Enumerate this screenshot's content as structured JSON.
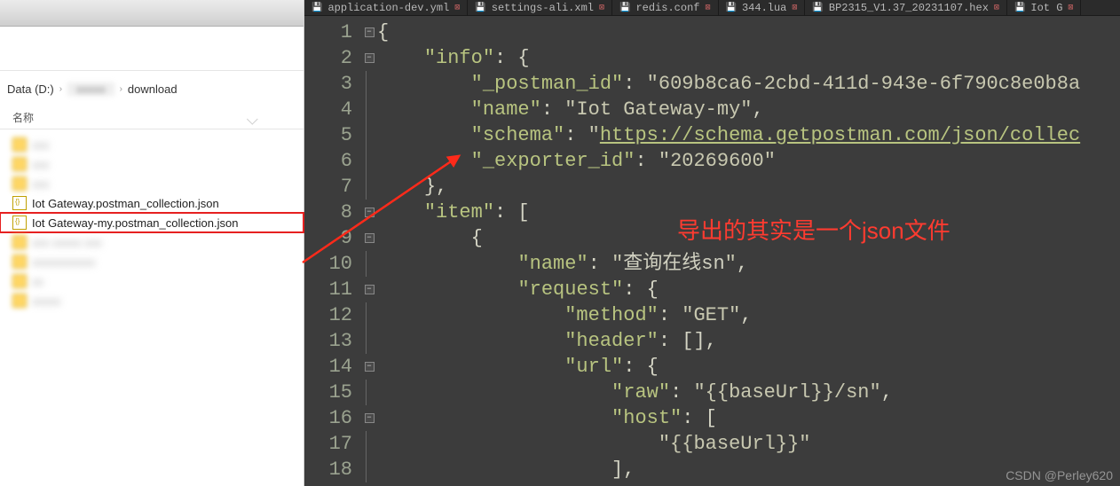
{
  "explorer": {
    "breadcrumb": {
      "drive": "Data (D:)",
      "mid_blur": "xxxxx",
      "folder": "download"
    },
    "column_header": "名称",
    "files": [
      {
        "label": "xxx",
        "icon": "folder",
        "blurred": true
      },
      {
        "label": "xxx",
        "icon": "folder",
        "blurred": true
      },
      {
        "label": "xxx",
        "icon": "folder",
        "blurred": true
      },
      {
        "label": "Iot Gateway.postman_collection.json",
        "icon": "json",
        "blurred": false
      },
      {
        "label": "Iot Gateway-my.postman_collection.json",
        "icon": "json",
        "blurred": false,
        "highlighted": true
      },
      {
        "label": "xxx xxxxx xxx",
        "icon": "folder",
        "blurred": true
      },
      {
        "label": "xxxxxxxxxxx",
        "icon": "folder",
        "blurred": true
      },
      {
        "label": "xx",
        "icon": "folder",
        "blurred": true
      },
      {
        "label": "xxxxx",
        "icon": "folder",
        "blurred": true
      }
    ]
  },
  "editor": {
    "tabs": [
      {
        "name": "application-dev.yml"
      },
      {
        "name": "settings-ali.xml"
      },
      {
        "name": "redis.conf"
      },
      {
        "name": "344.lua"
      },
      {
        "name": "BP2315_V1.37_20231107.hex"
      },
      {
        "name": "Iot G"
      }
    ],
    "json_content": {
      "info": {
        "_postman_id": "609b8ca6-2cbd-411d-943e-6f790c8e0b8a",
        "name": "Iot Gateway-my",
        "schema": "https://schema.getpostman.com/json/collec",
        "_exporter_id": "20269600"
      },
      "item": [
        {
          "name": "查询在线sn",
          "request": {
            "method": "GET",
            "header": [],
            "url": {
              "raw": "{{baseUrl}}/sn",
              "host": [
                "{{baseUrl}}"
              ]
            }
          }
        }
      ]
    },
    "annotation_text": "导出的其实是一个json文件",
    "watermark": "CSDN @Perley620",
    "line_count": 18
  }
}
